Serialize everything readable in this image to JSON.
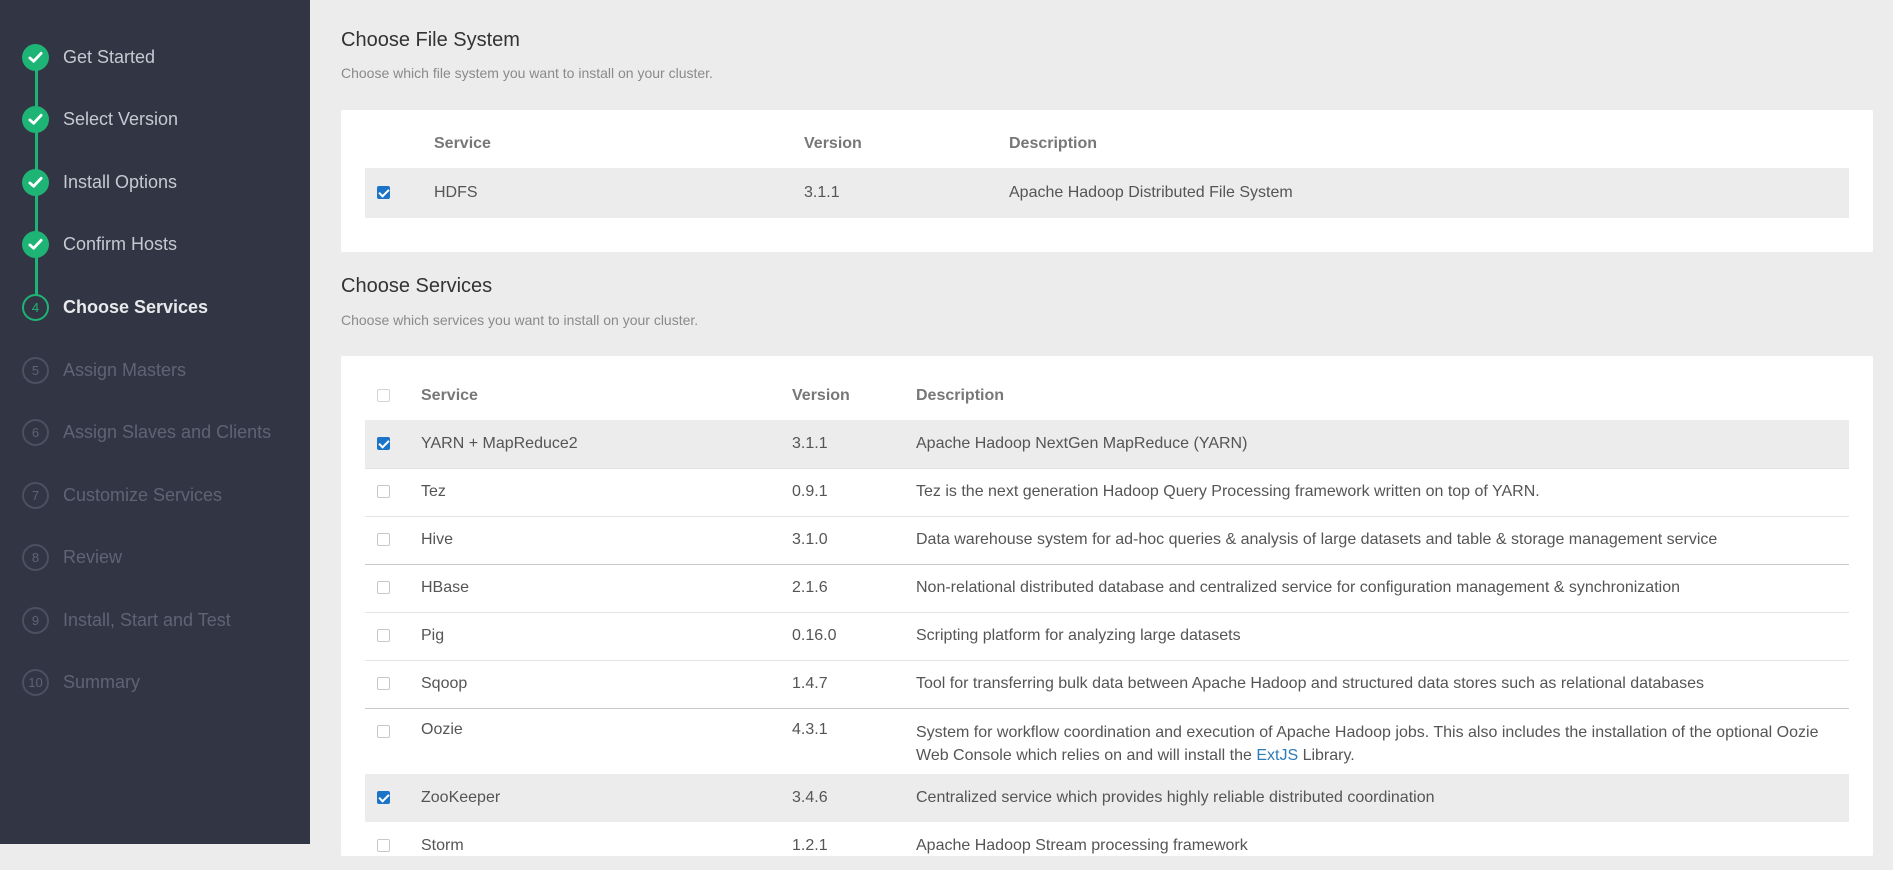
{
  "sidebar": {
    "steps": [
      {
        "label": "Get Started",
        "state": "done",
        "marker": ""
      },
      {
        "label": "Select Version",
        "state": "done",
        "marker": ""
      },
      {
        "label": "Install Options",
        "state": "done",
        "marker": ""
      },
      {
        "label": "Confirm Hosts",
        "state": "done",
        "marker": ""
      },
      {
        "label": "Choose Services",
        "state": "current",
        "marker": "4"
      },
      {
        "label": "Assign Masters",
        "state": "future",
        "marker": "5"
      },
      {
        "label": "Assign Slaves and Clients",
        "state": "future",
        "marker": "6"
      },
      {
        "label": "Customize Services",
        "state": "future",
        "marker": "7"
      },
      {
        "label": "Review",
        "state": "future",
        "marker": "8"
      },
      {
        "label": "Install, Start and Test",
        "state": "future",
        "marker": "9"
      },
      {
        "label": "Summary",
        "state": "future",
        "marker": "10"
      }
    ]
  },
  "file_system": {
    "title": "Choose File System",
    "subtitle": "Choose which file system you want to install on your cluster.",
    "columns": {
      "service": "Service",
      "version": "Version",
      "description": "Description"
    },
    "rows": [
      {
        "checked": true,
        "service": "HDFS",
        "version": "3.1.1",
        "description": "Apache Hadoop Distributed File System"
      }
    ]
  },
  "services": {
    "title": "Choose Services",
    "subtitle": "Choose which services you want to install on your cluster.",
    "columns": {
      "service": "Service",
      "version": "Version",
      "description": "Description"
    },
    "rows": [
      {
        "checked": true,
        "service": "YARN + MapReduce2",
        "version": "3.1.1",
        "description": "Apache Hadoop NextGen MapReduce (YARN)"
      },
      {
        "checked": false,
        "service": "Tez",
        "version": "0.9.1",
        "description": "Tez is the next generation Hadoop Query Processing framework written on top of YARN."
      },
      {
        "checked": false,
        "service": "Hive",
        "version": "3.1.0",
        "description": "Data warehouse system for ad-hoc queries & analysis of large datasets and table & storage management service"
      },
      {
        "checked": false,
        "service": "HBase",
        "version": "2.1.6",
        "description": "Non-relational distributed database and centralized service for configuration management & synchronization"
      },
      {
        "checked": false,
        "service": "Pig",
        "version": "0.16.0",
        "description": "Scripting platform for analyzing large datasets"
      },
      {
        "checked": false,
        "service": "Sqoop",
        "version": "1.4.7",
        "description": "Tool for transferring bulk data between Apache Hadoop and structured data stores such as relational databases"
      },
      {
        "checked": false,
        "service": "Oozie",
        "version": "4.3.1",
        "description_prefix": "System for workflow coordination and execution of Apache Hadoop jobs. This also includes the installation of the optional Oozie Web Console which relies on and will install the ",
        "description_link": "ExtJS",
        "description_suffix": " Library."
      },
      {
        "checked": true,
        "service": "ZooKeeper",
        "version": "3.4.6",
        "description": "Centralized service which provides highly reliable distributed coordination"
      },
      {
        "checked": false,
        "service": "Storm",
        "version": "1.2.1",
        "description": "Apache Hadoop Stream processing framework"
      }
    ]
  },
  "colors": {
    "sidebar_bg": "#323544",
    "accent_green": "#1eb475",
    "checkbox_blue": "#1b74c7",
    "link": "#2e7bb6"
  }
}
